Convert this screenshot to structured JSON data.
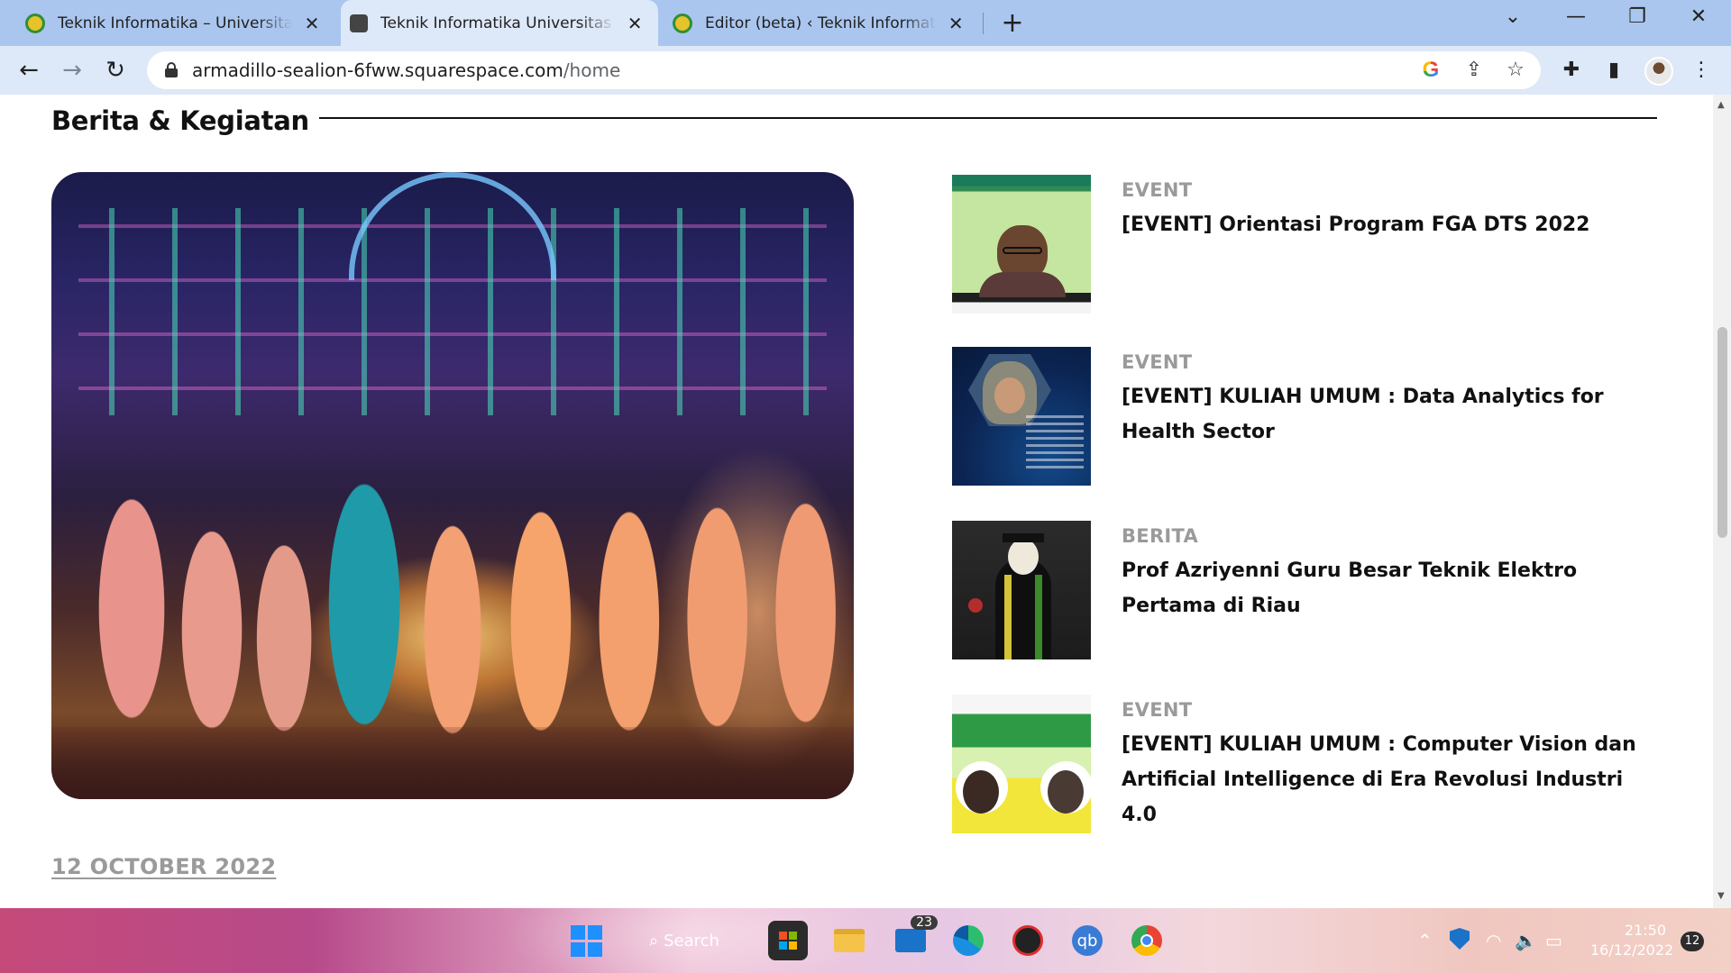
{
  "browser": {
    "tabs": [
      {
        "title": "Teknik Informatika – Universitas Riau",
        "close": "✕",
        "icon": "green-seal-icon",
        "active": false
      },
      {
        "title": "Teknik Informatika Universitas Riau",
        "close": "✕",
        "icon": "cube-icon",
        "active": true
      },
      {
        "title": "Editor (beta) ‹ Teknik Informatika",
        "close": "✕",
        "icon": "green-seal-icon",
        "active": false
      }
    ],
    "new_tab": "+",
    "window_controls": {
      "tab_search": "⌄",
      "minimize": "—",
      "restore": "❐",
      "close": "✕"
    },
    "nav": {
      "back": "←",
      "forward": "→",
      "reload": "↻"
    },
    "address": {
      "host": "armadillo-sealion-6fww.squarespace.com",
      "path": "/home"
    },
    "omnibox_icons": {
      "google": "G",
      "share": "⇪",
      "bookmark": "☆"
    },
    "toolbar_icons": {
      "extensions": "✚",
      "side_panel": "▮",
      "menu": "⋮"
    }
  },
  "page": {
    "section_title": "Berita & Kegiatan",
    "featured_date": "12 OCTOBER 2022",
    "news": [
      {
        "category": "EVENT",
        "headline": "[EVENT] Orientasi Program FGA DTS 2022"
      },
      {
        "category": "EVENT",
        "headline": "[EVENT] KULIAH UMUM : Data Analytics for Health Sector"
      },
      {
        "category": "BERITA",
        "headline": "Prof Azriyenni Guru Besar Teknik Elektro Pertama di Riau"
      },
      {
        "category": "EVENT",
        "headline": "[EVENT] KULIAH UMUM : Computer Vision dan Artificial Intelligence di Era Revolusi Industri 4.0"
      }
    ]
  },
  "scrollbar": {
    "up": "▲",
    "down": "▼"
  },
  "taskbar": {
    "search_label": "Search",
    "mail_badge": "23",
    "icons": [
      "windows-start-icon",
      "search-icon",
      "microsoft-store-icon",
      "file-explorer-icon",
      "mail-icon",
      "edge-icon",
      "app-icon",
      "qbittorrent-icon",
      "chrome-icon"
    ],
    "qb_label": "qb",
    "tray": {
      "chevron": "⌃",
      "wifi": "◠",
      "volume": "🔈",
      "battery": "▭"
    },
    "clock_time": "21:50",
    "clock_date": "16/12/2022",
    "notification_count": "12"
  }
}
